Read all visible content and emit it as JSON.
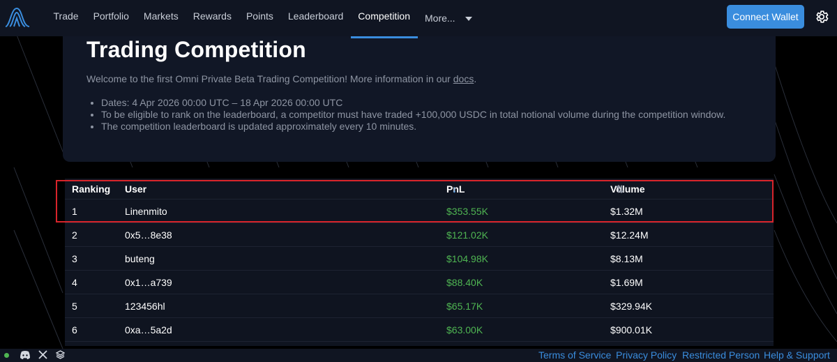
{
  "nav": {
    "items": [
      "Trade",
      "Portfolio",
      "Markets",
      "Rewards",
      "Points",
      "Leaderboard",
      "Competition"
    ],
    "active": "Competition",
    "more_label": "More...",
    "connect_label": "Connect Wallet"
  },
  "hero": {
    "title": "Trading Competition",
    "intro": "Welcome to the first Omni Private Beta Trading Competition! More information in our ",
    "docs_link": "docs",
    "intro_end": ".",
    "bullets": [
      "Dates: 4 Apr 2026 00:00 UTC – 18 Apr 2026 00:00 UTC",
      "To be eligible to rank on the leaderboard, a competitor must have traded +100,000 USDC in total notional volume during the competition window.",
      "The competition leaderboard is updated approximately every 10 minutes."
    ]
  },
  "table": {
    "headers": {
      "rank": "Ranking",
      "user": "User",
      "pnl": "PnL",
      "volume": "Volume"
    },
    "pnl_sort_icon": "↓",
    "volume_sort_icon": "⇅",
    "rows": [
      {
        "rank": "1",
        "user": "Linenmito",
        "pnl": "$353.55K",
        "volume": "$1.32M"
      },
      {
        "rank": "2",
        "user": "0x5…8e38",
        "pnl": "$121.02K",
        "volume": "$12.24M"
      },
      {
        "rank": "3",
        "user": "buteng",
        "pnl": "$104.98K",
        "volume": "$8.13M"
      },
      {
        "rank": "4",
        "user": "0x1…a739",
        "pnl": "$88.40K",
        "volume": "$1.69M"
      },
      {
        "rank": "5",
        "user": "123456hl",
        "pnl": "$65.17K",
        "volume": "$329.94K"
      },
      {
        "rank": "6",
        "user": "0xa…5a2d",
        "pnl": "$63.00K",
        "volume": "$900.01K"
      }
    ]
  },
  "footer": {
    "links": [
      "Terms of Service",
      "Privacy Policy",
      "Restricted Person",
      "Help & Support"
    ]
  },
  "colors": {
    "accent": "#3a8dde",
    "positive": "#4fb552",
    "highlight": "#d8242b"
  }
}
